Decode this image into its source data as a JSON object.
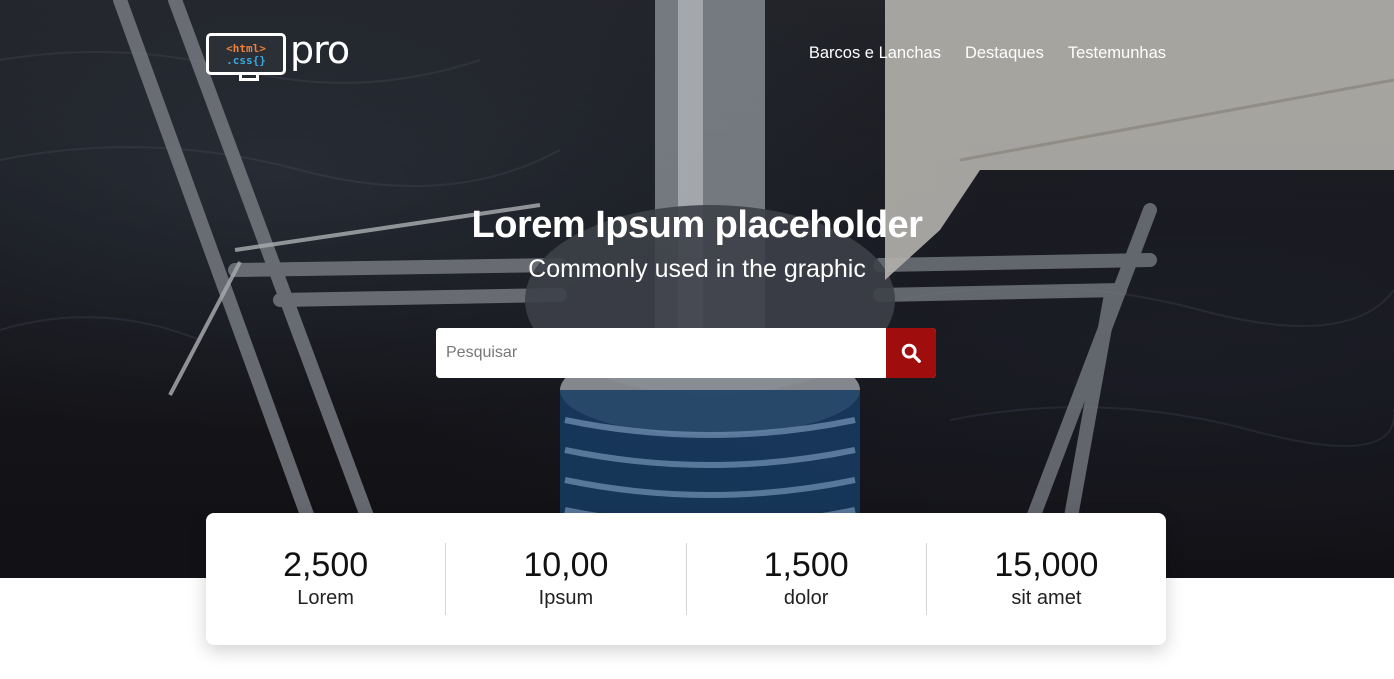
{
  "logo": {
    "monitor_line1": "<html>",
    "monitor_line2": ".css{}",
    "text": "pro"
  },
  "nav": {
    "items": [
      "Barcos e Lanchas",
      "Destaques",
      "Testemunhas"
    ]
  },
  "hero": {
    "title": "Lorem Ipsum placeholder",
    "subtitle": "Commonly used in the graphic"
  },
  "search": {
    "placeholder": "Pesquisar",
    "value": "",
    "button_icon": "search-icon"
  },
  "stats": [
    {
      "value": "2,500",
      "label": "Lorem"
    },
    {
      "value": "10,00",
      "label": "Ipsum"
    },
    {
      "value": "1,500",
      "label": "dolor"
    },
    {
      "value": "15,000",
      "label": "sit amet"
    }
  ],
  "colors": {
    "accent": "#a00d0d",
    "text_light": "#ffffff",
    "text_dark": "#111111"
  }
}
